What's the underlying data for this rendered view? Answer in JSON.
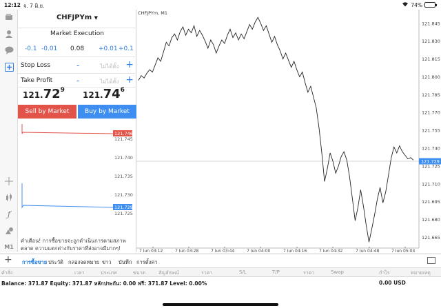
{
  "status": {
    "time": "12:12",
    "date": "จ. 7 มิ.ย.",
    "battery": "74%",
    "battery_level": 0.74
  },
  "toolbar_left": [
    {
      "icon": "wallet-icon"
    },
    {
      "icon": "user-icon"
    },
    {
      "icon": "chat-icon"
    },
    {
      "icon": "new-order-icon"
    },
    {
      "icon": "crosshair-icon"
    },
    {
      "icon": "candles-icon"
    },
    {
      "icon": "function-icon"
    },
    {
      "icon": "objects-icon"
    },
    {
      "icon": "timeframe-label",
      "label": "M1"
    }
  ],
  "order": {
    "symbol": "CHFJPYm",
    "symbol_arrow": "▼",
    "execution": "Market Execution",
    "steps": [
      "-0.1",
      "-0.01",
      "0.08",
      "+0.01",
      "+0.1"
    ],
    "stop_loss": {
      "label": "Stop Loss",
      "minus": "-",
      "placeholder": "ไม่ได้ตั้ง",
      "plus": "+"
    },
    "take_profit": {
      "label": "Take Profit",
      "minus": "-",
      "placeholder": "ไม่ได้ตั้ง",
      "plus": "+"
    },
    "bid": {
      "small": "121.",
      "large": "72",
      "sup": "9"
    },
    "ask": {
      "small": "121.",
      "large": "74",
      "sup": "6"
    },
    "sell_label": "Sell by Market",
    "buy_label": "Buy by Market",
    "warning": "คำเตือน! การซื้อขายจะถูกดำเนินการตามสภาพตลาด ความแตกต่างกับราคาที่ส่งอาจมีมากๆ!"
  },
  "mini_chart": {
    "ask_label": "121.746",
    "bid_label": "121.729",
    "ticks": [
      "121.745",
      "121.740",
      "121.735",
      "121.730",
      "121.725"
    ],
    "ask_color": "#e2534a",
    "bid_color": "#3d8ef0"
  },
  "chart_data": {
    "type": "line",
    "title": "CHFJPYm, M1",
    "x_labels": [
      "7 Jun 03:12",
      "7 Jun 03:28",
      "7 Jun 03:44",
      "7 Jun 04:00",
      "7 Jun 04:16",
      "7 Jun 04:32",
      "7 Jun 04:48",
      "7 Jun 05:04"
    ],
    "y_labels": [
      "121.845",
      "121.830",
      "121.815",
      "121.800",
      "121.785",
      "121.770",
      "121.755",
      "121.740",
      "121.725",
      "121.710",
      "121.695",
      "121.680",
      "121.665"
    ],
    "ylim": [
      121.656,
      121.853
    ],
    "current_label": "121.729",
    "current_value": 121.729,
    "current_color": "#3d8ef0",
    "values": [
      121.797,
      121.801,
      121.799,
      121.803,
      121.806,
      121.804,
      121.81,
      121.816,
      121.813,
      121.821,
      121.829,
      121.826,
      121.833,
      121.836,
      121.831,
      121.838,
      121.842,
      121.835,
      121.84,
      121.837,
      121.843,
      121.834,
      121.839,
      121.835,
      121.83,
      121.824,
      121.831,
      121.827,
      121.82,
      121.826,
      121.831,
      121.828,
      121.835,
      121.84,
      121.833,
      121.837,
      121.831,
      121.836,
      121.832,
      121.838,
      121.844,
      121.84,
      121.846,
      121.85,
      121.845,
      121.839,
      121.843,
      121.836,
      121.829,
      121.834,
      121.827,
      121.822,
      121.815,
      121.82,
      121.814,
      121.808,
      121.813,
      121.806,
      121.8,
      121.804,
      121.795,
      121.787,
      121.792,
      121.783,
      121.774,
      121.757,
      121.736,
      121.712,
      121.723,
      121.736,
      121.729,
      121.719,
      121.725,
      121.733,
      121.737,
      121.73,
      121.716,
      121.698,
      121.679,
      121.69,
      121.705,
      121.691,
      121.675,
      121.661,
      121.672,
      121.684,
      121.697,
      121.707,
      121.694,
      121.703,
      121.717,
      121.732,
      121.741,
      121.736,
      121.742,
      121.737,
      121.734,
      121.731,
      121.732,
      121.73
    ]
  },
  "tabs": [
    "การซื้อขาย",
    "ประวัติ",
    "กล่องจดหมาย",
    "ข่าว",
    "บันทึก",
    "การตั้งค่า"
  ],
  "columns": [
    "คำสั่ง",
    "เวลา",
    "ประเภท",
    "ขนาด",
    "สัญลักษณ์",
    "ราคา",
    "S/L",
    "T/P",
    "ราคา",
    "Swap",
    "กำไร",
    "หมายเหตุ"
  ],
  "balance": {
    "text": "Balance: 371.87 Equity: 371.87 หลักประกัน: 0.00 ฟรี: 371.87 Level: 0.00%",
    "profit": "0.00  USD"
  }
}
